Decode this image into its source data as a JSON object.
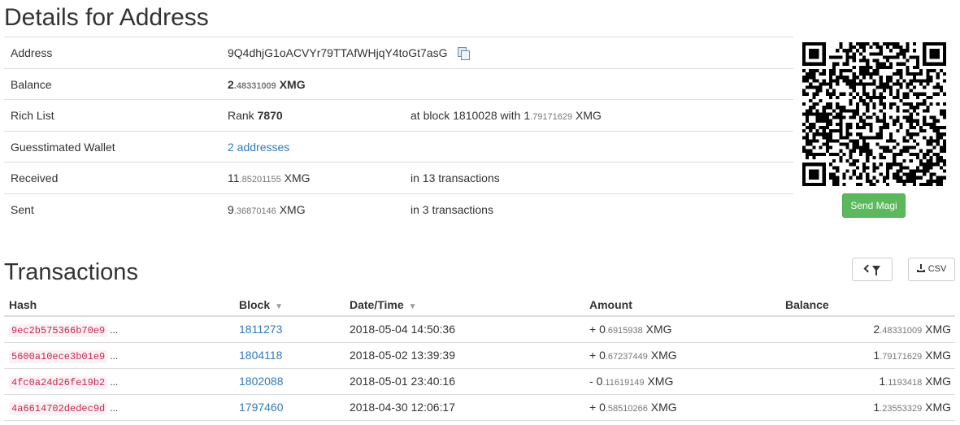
{
  "page_title": "Details for Address",
  "details": {
    "address": {
      "label": "Address",
      "value": "9Q4dhjG1oACVYr79TTAfWHjqY4toGt7asG"
    },
    "balance": {
      "label": "Balance",
      "int": "2",
      "frac": ".48331009",
      "unit": "XMG"
    },
    "rich_list": {
      "label": "Rich List",
      "rank_prefix": "Rank",
      "rank": "7870",
      "block_text": "at block 1810028 with",
      "int": "1",
      "frac": ".79171629",
      "unit": "XMG"
    },
    "wallet": {
      "label": "Guesstimated Wallet",
      "value": "2 addresses"
    },
    "received": {
      "label": "Received",
      "int": "11",
      "frac": ".85201155",
      "unit": "XMG",
      "tx_text": "in 13 transactions"
    },
    "sent": {
      "label": "Sent",
      "int": "9",
      "frac": ".36870146",
      "unit": "XMG",
      "tx_text": "in 3 transactions"
    }
  },
  "send_button": "Send Magi",
  "transactions_title": "Transactions",
  "csv_button": "CSV",
  "icons": {
    "copy": "copy-icon",
    "filter": "filter-icon",
    "download": "download-icon",
    "sort": "sort-desc-icon"
  },
  "colors": {
    "send_button": "#5cb85c",
    "link": "#337ab7",
    "hash": "#c7254e"
  },
  "table": {
    "headers": {
      "hash": "Hash",
      "block": "Block",
      "datetime": "Date/Time",
      "amount": "Amount",
      "balance": "Balance"
    },
    "rows": [
      {
        "hash": "9ec2b575366b70e9",
        "ellipsis": "...",
        "block": "1811273",
        "datetime": "2018-05-04 14:50:36",
        "amt_sign": "+ ",
        "amt_int": "0",
        "amt_frac": ".6915938",
        "bal_int": "2",
        "bal_frac": ".48331009",
        "unit": "XMG"
      },
      {
        "hash": "5600a10ece3b01e9",
        "ellipsis": "...",
        "block": "1804118",
        "datetime": "2018-05-02 13:39:39",
        "amt_sign": "+ ",
        "amt_int": "0",
        "amt_frac": ".67237449",
        "bal_int": "1",
        "bal_frac": ".79171629",
        "unit": "XMG"
      },
      {
        "hash": "4fc0a24d26fe19b2",
        "ellipsis": "...",
        "block": "1802088",
        "datetime": "2018-05-01 23:40:16",
        "amt_sign": "- ",
        "amt_int": "0",
        "amt_frac": ".11619149",
        "bal_int": "1",
        "bal_frac": ".1193418",
        "unit": "XMG"
      },
      {
        "hash": "4a6614702dedec9d",
        "ellipsis": "...",
        "block": "1797460",
        "datetime": "2018-04-30 12:06:17",
        "amt_sign": "+ ",
        "amt_int": "0",
        "amt_frac": ".58510266",
        "bal_int": "1",
        "bal_frac": ".23553329",
        "unit": "XMG"
      }
    ]
  }
}
